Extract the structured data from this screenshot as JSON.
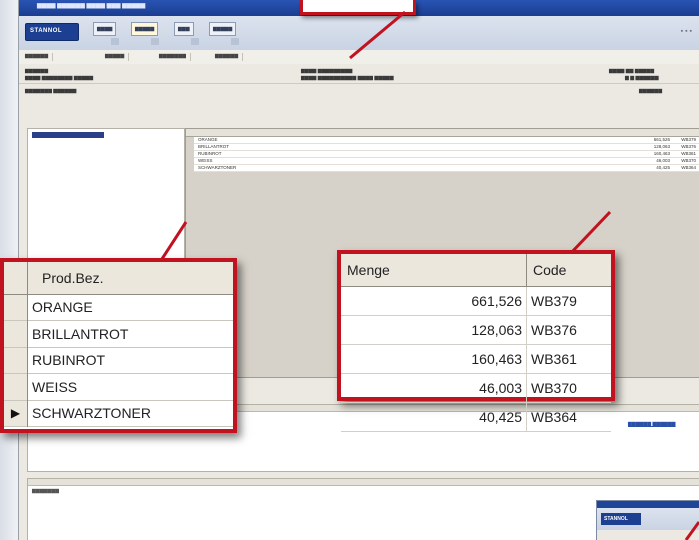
{
  "colors": {
    "callout_border": "#c1121f",
    "title_bar": "#1f4598",
    "selection": "#2b3f86"
  },
  "app": {
    "logo_text": "STANNOL",
    "mini_logo_text": "STANNOL"
  },
  "product_callout": {
    "header": "Prod.Bez.",
    "rows": [
      "ORANGE",
      "BRILLANTROT",
      "RUBINROT",
      "WEISS",
      "SCHWARZTONER"
    ],
    "current_row_index": 4,
    "current_row_marker": "▶"
  },
  "quantity_callout": {
    "headers": {
      "menge": "Menge",
      "code": "Code"
    },
    "rows": [
      {
        "menge": "661,526",
        "code": "WB379"
      },
      {
        "menge": "128,063",
        "code": "WB376"
      },
      {
        "menge": "160,463",
        "code": "WB361"
      },
      {
        "menge": "46,003",
        "code": "WB370"
      },
      {
        "menge": "40,425",
        "code": "WB364"
      }
    ]
  }
}
